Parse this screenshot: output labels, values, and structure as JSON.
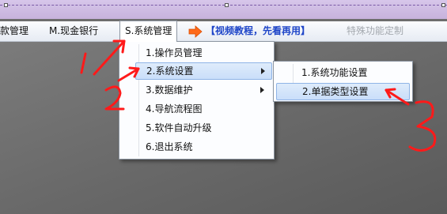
{
  "menubar": {
    "items": [
      {
        "label": "款管理"
      },
      {
        "label": "M.现金银行"
      },
      {
        "label": "S.系统管理"
      }
    ],
    "tutorial_label": "【视频教程，先看再用】",
    "disabled_label": "特殊功能定制"
  },
  "system_menu": {
    "items": [
      {
        "label": "1.操作员管理"
      },
      {
        "label": "2.系统设置"
      },
      {
        "label": "3.数据维护"
      },
      {
        "label": "4.导航流程图"
      },
      {
        "label": "5.软件自动升级"
      },
      {
        "label": "6.退出系统"
      }
    ]
  },
  "settings_submenu": {
    "items": [
      {
        "label": "1.系统功能设置"
      },
      {
        "label": "2.单据类型设置"
      }
    ]
  },
  "annotations": {
    "color": "#ff1a1a",
    "step_numbers": [
      1,
      2,
      3
    ]
  },
  "colors": {
    "tutorial_text": "#1e45c8",
    "highlight": "#c9defa",
    "arrow_icon": "#ff6a1a"
  }
}
